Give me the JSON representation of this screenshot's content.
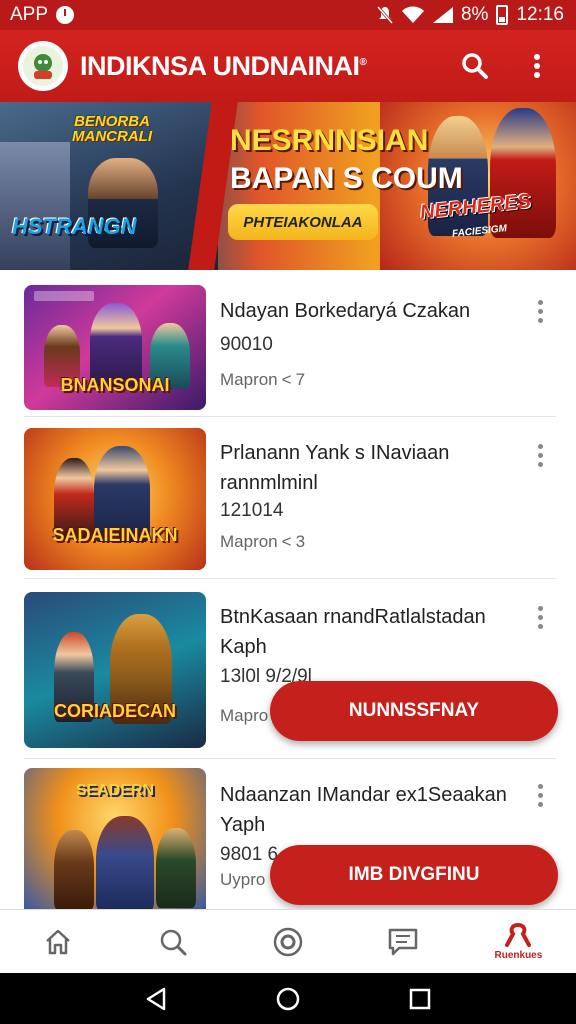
{
  "status_bar": {
    "left_label": "APP",
    "battery": "8%",
    "time": "12:16"
  },
  "app_bar": {
    "title": "INDIKNSA UNDNAINAI",
    "trademark": "®"
  },
  "hero": {
    "left_title": "BENORBA MANCRALI",
    "left_sub": "HSTRANGN",
    "headline_1": "NESRNNSIAN",
    "headline_2": "BAPAN S COUM",
    "chip": "PHTEIAKONLAA",
    "right_logo": "NERHERES",
    "right_sub": "FACIESIGM"
  },
  "items": [
    {
      "thumb_label": "BNANSONAI",
      "title": "Ndayan Borkedaryá Czakan",
      "count": "90010",
      "meta": "Mapron",
      "shares": "7"
    },
    {
      "thumb_label": "SADAIEINAKN",
      "title": "Prlanann Yank s INaviaan rannmlminl",
      "count": "121014",
      "meta": "Mapron",
      "shares": "3"
    },
    {
      "thumb_label": "CORIADECAN",
      "title": "BtnKasaan rnandRatlalstadan Kaph",
      "count": "13l0l 9/2/9l",
      "meta": "Mapro",
      "shares": ""
    },
    {
      "thumb_label": "SEADERN",
      "title": "Ndaanzan IMandar ex1Seaakan Yaph",
      "count": "9801 6",
      "meta": "Uypro",
      "shares": ""
    }
  ],
  "fabs": {
    "primary": "NUNNSSFNAY",
    "secondary": "IMB DIVGFINU"
  },
  "bottom_nav": {
    "active_label": "Ruenkues"
  },
  "colors": {
    "brand_red": "#c5201b",
    "status_red": "#b81a1a"
  }
}
